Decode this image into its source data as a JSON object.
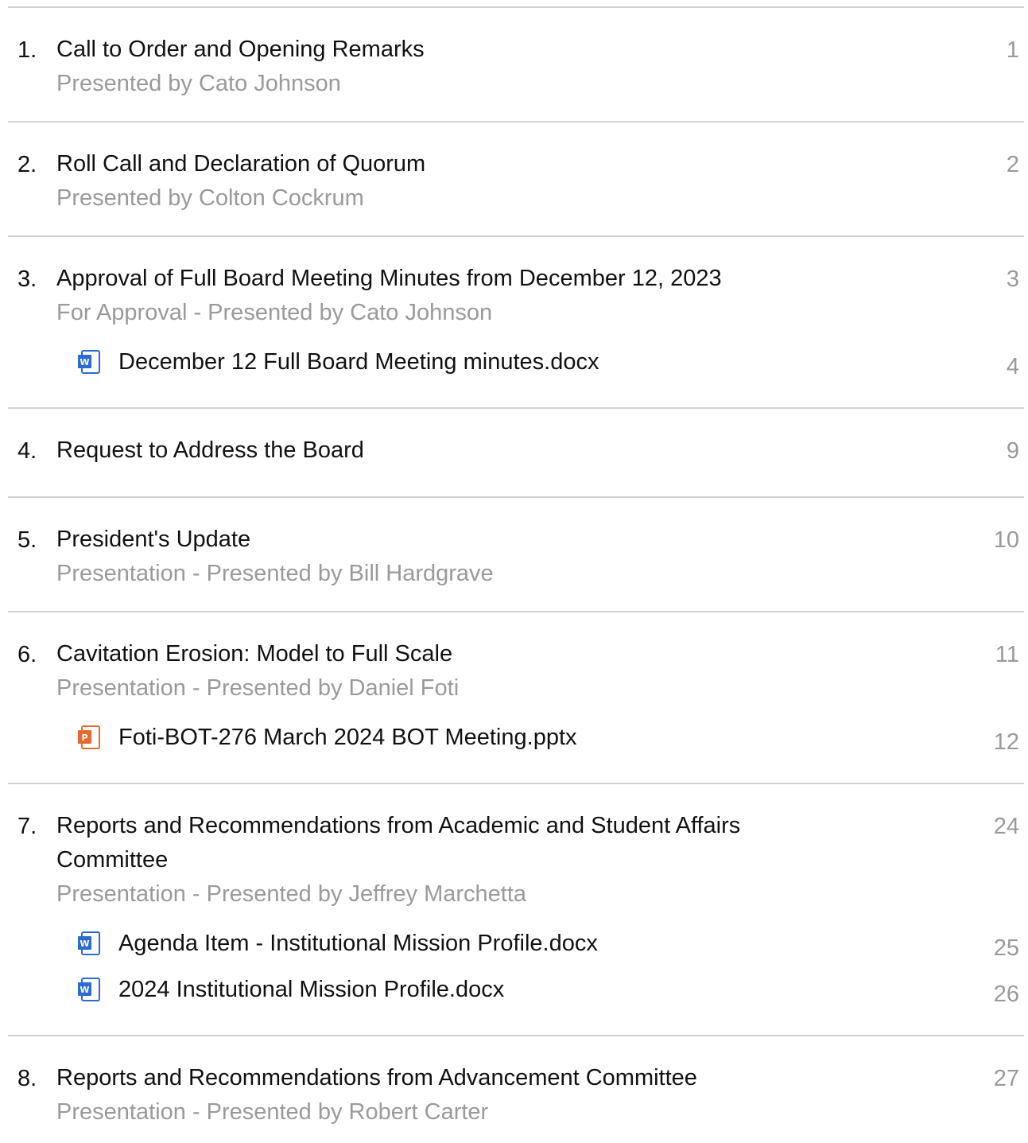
{
  "items": [
    {
      "number": "1.",
      "title": "Call to Order and Opening Remarks",
      "subtitle": "Presented by Cato Johnson",
      "page": "1"
    },
    {
      "number": "2.",
      "title": "Roll Call and Declaration of Quorum",
      "subtitle": "Presented by Colton Cockrum",
      "page": "2"
    },
    {
      "number": "3.",
      "title": "Approval of Full Board Meeting Minutes from December 12, 2023",
      "subtitle": "For Approval - Presented by Cato Johnson",
      "page": "3",
      "attachments": [
        {
          "name": "December 12 Full Board Meeting minutes.docx",
          "icon": "word-document-icon",
          "page": "4"
        }
      ]
    },
    {
      "number": "4.",
      "title": "Request to Address the Board",
      "page": "9"
    },
    {
      "number": "5.",
      "title": "President's Update",
      "subtitle": "Presentation - Presented by Bill Hardgrave",
      "page": "10"
    },
    {
      "number": "6.",
      "title": "Cavitation Erosion: Model to Full Scale",
      "subtitle": "Presentation - Presented by Daniel Foti",
      "page": "11",
      "attachments": [
        {
          "name": "Foti-BOT-276 March 2024 BOT Meeting.pptx",
          "icon": "powerpoint-document-icon",
          "page": "12"
        }
      ]
    },
    {
      "number": "7.",
      "title_line1": "Reports and Recommendations from Academic and Student Affairs",
      "title_line2": "Committee",
      "subtitle": "Presentation - Presented by Jeffrey Marchetta",
      "page": "24",
      "attachments": [
        {
          "name": "Agenda Item - Institutional Mission Profile.docx",
          "icon": "word-document-icon",
          "page": "25"
        },
        {
          "name": "2024 Institutional Mission Profile.docx",
          "icon": "word-document-icon",
          "page": "26"
        }
      ]
    },
    {
      "number": "8.",
      "title": "Reports and Recommendations from Advancement Committee",
      "subtitle": "Presentation - Presented by Robert Carter",
      "page": "27"
    }
  ],
  "colors": {
    "primary_text": "#111111",
    "secondary_text": "#9a9a9a",
    "divider": "#d2d2d2",
    "word_icon": "#2b6bd3",
    "powerpoint_icon": "#e8692e"
  }
}
